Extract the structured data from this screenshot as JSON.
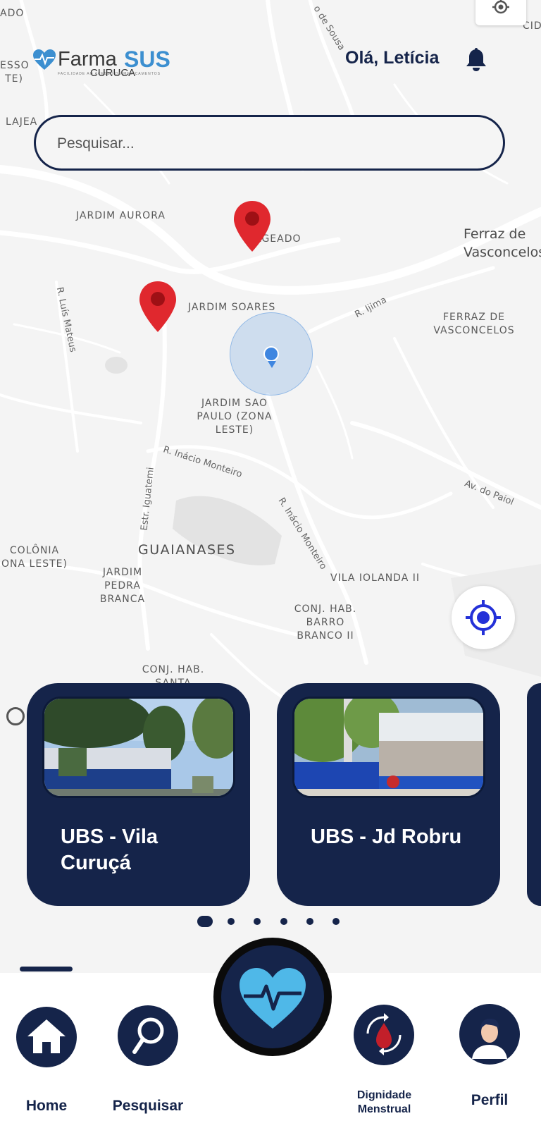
{
  "header": {
    "logo_farma": "Farma",
    "logo_sus": "SUS",
    "logo_sub": "CURUCA",
    "logo_tagline": "FACILIDADE AO ACESSO DE MEDICAMENTOS",
    "greeting": "Olá, Letícia"
  },
  "search": {
    "placeholder": "Pesquisar..."
  },
  "map": {
    "labels": {
      "jardim_aurora": "JARDIM AURORA",
      "lageado": "LAGEADO",
      "jardim_soares": "JARDIM SOARES",
      "ferraz_city": "Ferraz de Vasconcelos",
      "ferraz_district": "FERRAZ DE VASCONCELOS",
      "jardim_sao_paulo": "JARDIM SAO PAULO (ZONA LESTE)",
      "guaianases": "GUAIANASES",
      "jardim_pedra_branca": "JARDIM PEDRA BRANCA",
      "vila_iolanda": "VILA IOLANDA II",
      "barro_branco": "CONJ. HAB. BARRO BRANCO II",
      "conj_hab_santa": "CONJ. HAB. SANTA",
      "colonia": "COLÔNIA ONA LESTE)",
      "lajeado_left": "LAJEA",
      "esso": "ESSO TE)",
      "cid": "CID",
      "ado": "ADO"
    },
    "streets": {
      "luis_mateus": "R. Luís Mateus",
      "ijima": "R. Ijima",
      "inacio_monteiro_1": "R. Inácio Monteiro",
      "inacio_monteiro_2": "R. Inácio Monteiro",
      "iguatemi": "Estr. Iguatemi",
      "paiol": "Av. do Paiol",
      "sousa": "o de Sousa"
    }
  },
  "cards": [
    {
      "name": "UBS - Vila Curuçá"
    },
    {
      "name": "UBS - Jd Robru"
    }
  ],
  "carousel": {
    "pages": 6,
    "active": 0
  },
  "nav": {
    "home": "Home",
    "search": "Pesquisar",
    "dignidade": "Dignidade Menstrual",
    "perfil": "Perfil"
  },
  "colors": {
    "navy": "#15244a",
    "accent_blue": "#3c8fd0",
    "heart_blue": "#4fb8e8",
    "pin_red": "#e0282e",
    "locate_blue": "#2431d8"
  }
}
